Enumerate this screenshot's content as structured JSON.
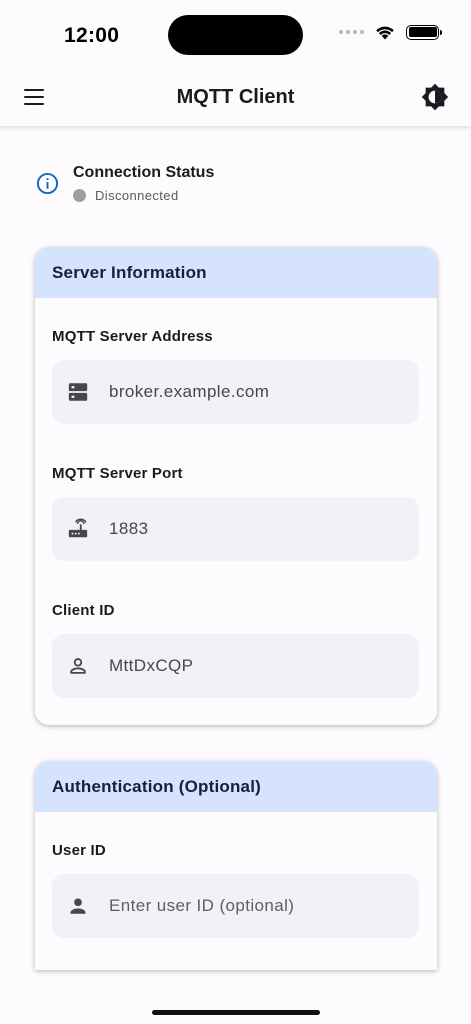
{
  "status_bar": {
    "time": "12:00"
  },
  "app_bar": {
    "title": "MQTT Client",
    "menu_icon": "hamburger-menu-icon",
    "theme_icon": "brightness-icon"
  },
  "connection": {
    "title": "Connection Status",
    "status": "Disconnected",
    "status_color": "#9e9e9e",
    "icon": "info-icon"
  },
  "server_card": {
    "header": "Server Information",
    "fields": [
      {
        "label": "MQTT Server Address",
        "value": "broker.example.com",
        "placeholder": "",
        "icon": "server-icon"
      },
      {
        "label": "MQTT Server Port",
        "value": "1883",
        "placeholder": "",
        "icon": "router-icon"
      },
      {
        "label": "Client ID",
        "value": "MttDxCQP",
        "placeholder": "",
        "icon": "person-outline-icon"
      }
    ]
  },
  "auth_card": {
    "header": "Authentication (Optional)",
    "fields": [
      {
        "label": "User ID",
        "value": "",
        "placeholder": "Enter user ID (optional)",
        "icon": "person-icon"
      }
    ]
  },
  "colors": {
    "accent": "#1565c0",
    "header_bg": "#d6e3fd",
    "field_bg": "#f3f1f7",
    "background": "#fdfbfe"
  }
}
